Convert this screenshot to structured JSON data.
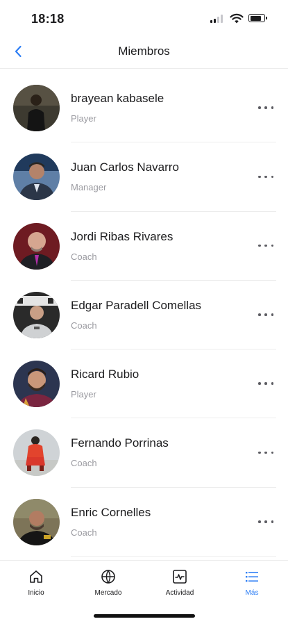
{
  "status_bar": {
    "time": "18:18"
  },
  "nav": {
    "title": "Miembros"
  },
  "members": [
    {
      "name": "brayean kabasele",
      "role": "Player"
    },
    {
      "name": "Juan Carlos Navarro",
      "role": "Manager"
    },
    {
      "name": "Jordi Ribas Rivares",
      "role": "Coach"
    },
    {
      "name": "Edgar Paradell Comellas",
      "role": "Coach"
    },
    {
      "name": "Ricard Rubio",
      "role": "Player"
    },
    {
      "name": "Fernando Porrinas",
      "role": "Coach"
    },
    {
      "name": "Enric Cornelles",
      "role": "Coach"
    }
  ],
  "tabs": [
    {
      "label": "Inicio",
      "icon": "home-icon",
      "active": false
    },
    {
      "label": "Mercado",
      "icon": "basketball-icon",
      "active": false
    },
    {
      "label": "Actividad",
      "icon": "activity-icon",
      "active": false
    },
    {
      "label": "Más",
      "icon": "list-icon",
      "active": true
    }
  ],
  "colors": {
    "accent": "#2f7ff5",
    "text": "#1c1c1e",
    "secondary_text": "#9a9aa0",
    "divider": "#ececec"
  }
}
